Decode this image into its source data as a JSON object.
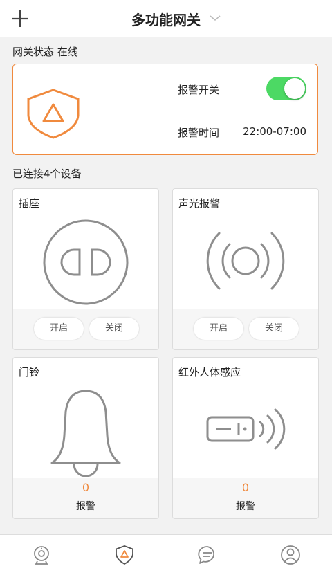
{
  "header": {
    "title": "多功能网关",
    "add_icon": "plus-icon",
    "dropdown_icon": "chevron-down-icon"
  },
  "gateway": {
    "status_label": "网关状态 在线",
    "alarm_switch_label": "报警开关",
    "alarm_switch_on": true,
    "alarm_time_label": "报警时间",
    "alarm_time_value": "22:00-07:00",
    "accent_color": "#f08a3e",
    "toggle_color": "#4cd964"
  },
  "devices_label": "已连接4个设备",
  "devices": [
    {
      "name": "插座",
      "icon": "socket-icon",
      "buttons": [
        "开启",
        "关闭"
      ]
    },
    {
      "name": "声光报警",
      "icon": "siren-icon",
      "buttons": [
        "开启",
        "关闭"
      ]
    },
    {
      "name": "门铃",
      "icon": "bell-icon",
      "count": "0",
      "count_label": "报警"
    },
    {
      "name": "红外人体感应",
      "icon": "motion-sensor-icon",
      "count": "0",
      "count_label": "报警"
    }
  ],
  "tabbar": [
    "camera-icon",
    "shield-alert-icon",
    "chat-icon",
    "user-icon"
  ]
}
